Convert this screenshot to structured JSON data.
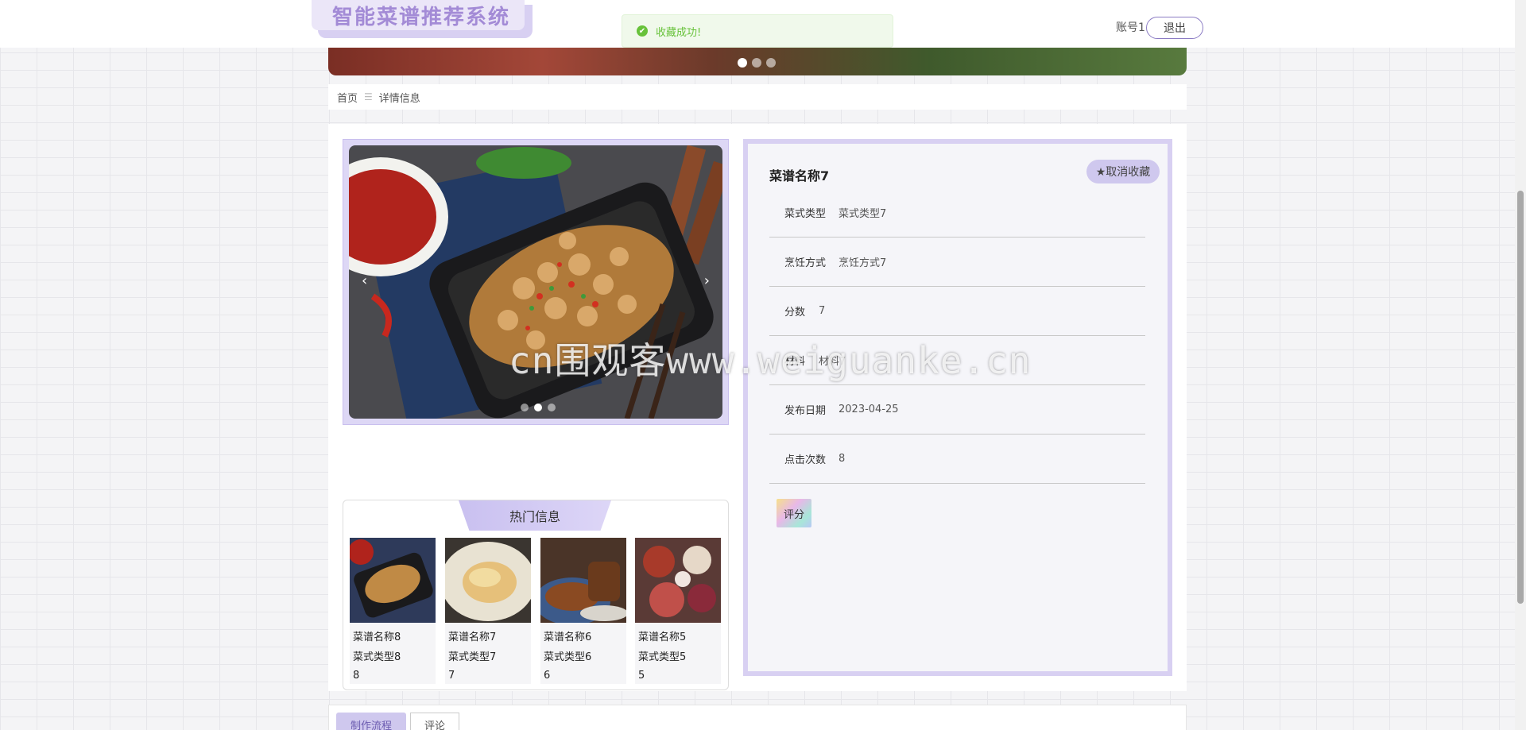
{
  "header": {
    "logo_text": "智能菜谱推荐系统",
    "account_label": "账号1",
    "logout_label": "退出"
  },
  "toast": {
    "message": "收藏成功!"
  },
  "breadcrumb": {
    "home": "首页",
    "separator": "☰",
    "current": "详情信息"
  },
  "gallery": {
    "prev": "‹",
    "next": "›",
    "active_index": 1,
    "count": 3
  },
  "details": {
    "title": "菜谱名称7",
    "favorite_label": "★取消收藏",
    "rows": [
      {
        "label": "菜式类型",
        "value": "菜式类型7"
      },
      {
        "label": "烹饪方式",
        "value": "烹饪方式7"
      },
      {
        "label": "分数",
        "value": "7"
      },
      {
        "label": "材料",
        "value": "材料7"
      },
      {
        "label": "发布日期",
        "value": "2023-04-25"
      },
      {
        "label": "点击次数",
        "value": "8"
      }
    ],
    "rate_label": "评分"
  },
  "hot": {
    "title": "热门信息",
    "items": [
      {
        "name": "菜谱名称8",
        "type": "菜式类型8",
        "score": "8"
      },
      {
        "name": "菜谱名称7",
        "type": "菜式类型7",
        "score": "7"
      },
      {
        "name": "菜谱名称6",
        "type": "菜式类型6",
        "score": "6"
      },
      {
        "name": "菜谱名称5",
        "type": "菜式类型5",
        "score": "5"
      }
    ]
  },
  "tabs": {
    "process": "制作流程",
    "comments": "评论"
  },
  "watermark": "cn围观客www.weiguanke.cn",
  "colors": {
    "accent": "#cfc8ee",
    "border": "#d8d0f2",
    "logo": "#a38bd6",
    "success": "#67c23a"
  }
}
